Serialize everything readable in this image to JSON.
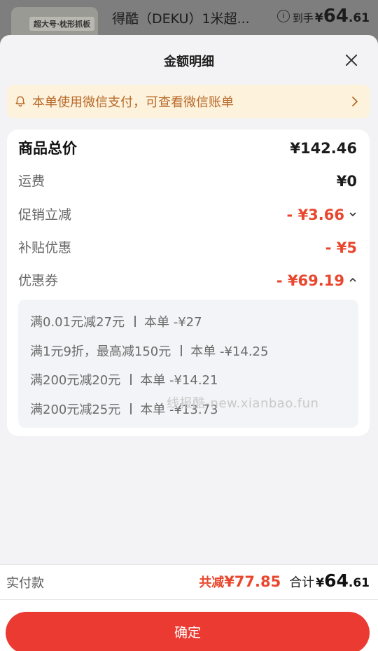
{
  "background_product": {
    "thumb_tag": "超大号·枕形抓板",
    "title": "得酷（DEKU）1米超...",
    "info_icon": "info-icon",
    "price_label": "到手",
    "price_yen": "¥",
    "price_int": "64",
    "price_dec": ".61"
  },
  "sheet": {
    "title": "金额明细",
    "close_icon": "close-icon"
  },
  "notice": {
    "icon": "bell-icon",
    "text": "本单使用微信支付，可查看微信账单",
    "chevron": "chevron-right-icon"
  },
  "breakdown": {
    "total": {
      "label": "商品总价",
      "value": "¥142.46"
    },
    "shipping": {
      "label": "运费",
      "value": "¥0"
    },
    "promo": {
      "label": "促销立减",
      "value": "- ¥3.66"
    },
    "subsidy": {
      "label": "补贴优惠",
      "value": "- ¥5"
    },
    "coupon": {
      "label": "优惠券",
      "value": "- ¥69.19"
    }
  },
  "coupons": [
    {
      "rule": "满0.01元减27元",
      "amount": "本单 -¥27"
    },
    {
      "rule": "满1元9折，最高减150元",
      "amount": "本单 -¥14.25"
    },
    {
      "rule": "满200元减20元",
      "amount": "本单 -¥14.21"
    },
    {
      "rule": "满200元减25元",
      "amount": "本单 -¥13.73"
    }
  ],
  "watermark": "线报酷-new.xianbao.fun",
  "footer": {
    "pay_label": "实付款",
    "discount_label": "共减",
    "discount_value": "¥77.85",
    "sum_label": "合计",
    "sum_yen": "¥",
    "sum_int": "64",
    "sum_dec": ".61",
    "confirm_label": "确定"
  },
  "colors": {
    "accent_red": "#ea3a32",
    "discount_red": "#e8472e",
    "notice_bg": "#fdf2dc",
    "notice_text": "#b86a2a"
  }
}
